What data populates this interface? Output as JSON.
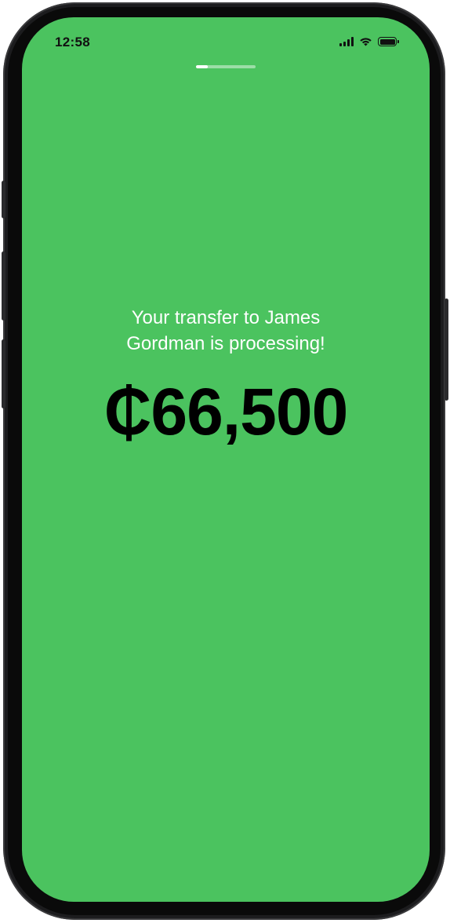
{
  "status_bar": {
    "time": "12:58",
    "icons": [
      "cellular-signal-icon",
      "wifi-icon",
      "battery-icon"
    ]
  },
  "transfer": {
    "progress": 0.2,
    "message_line1": "Your transfer to James",
    "message_line2": "Gordman is processing!",
    "amount": "₵66,500"
  },
  "colors": {
    "screen_background": "#4bc35f",
    "message_text": "#ffffff",
    "amount_text": "#000000",
    "device_frame": "#1c1c1e"
  }
}
